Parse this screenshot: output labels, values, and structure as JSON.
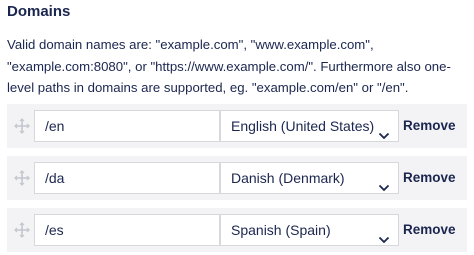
{
  "section": {
    "title": "Domains",
    "description": "Valid domain names are: \"example.com\", \"www.example.com\", \"example.com:8080\", or \"https://www.example.com/\". Furthermore also one-level paths in domains are supported, eg. \"example.com/en\" or \"/en\"."
  },
  "rows": [
    {
      "domain": "/en",
      "language": "English (United States)",
      "remove_label": "Remove"
    },
    {
      "domain": "/da",
      "language": "Danish (Denmark)",
      "remove_label": "Remove"
    },
    {
      "domain": "/es",
      "language": "Spanish (Spain)",
      "remove_label": "Remove"
    }
  ],
  "icons": {
    "drag": "drag-handle-icon",
    "dropdown": "chevron-down-icon"
  },
  "colors": {
    "text": "#1b264f",
    "row_background": "#f3f3f5",
    "border": "#d6d8de",
    "handle": "#c4c6cf"
  }
}
